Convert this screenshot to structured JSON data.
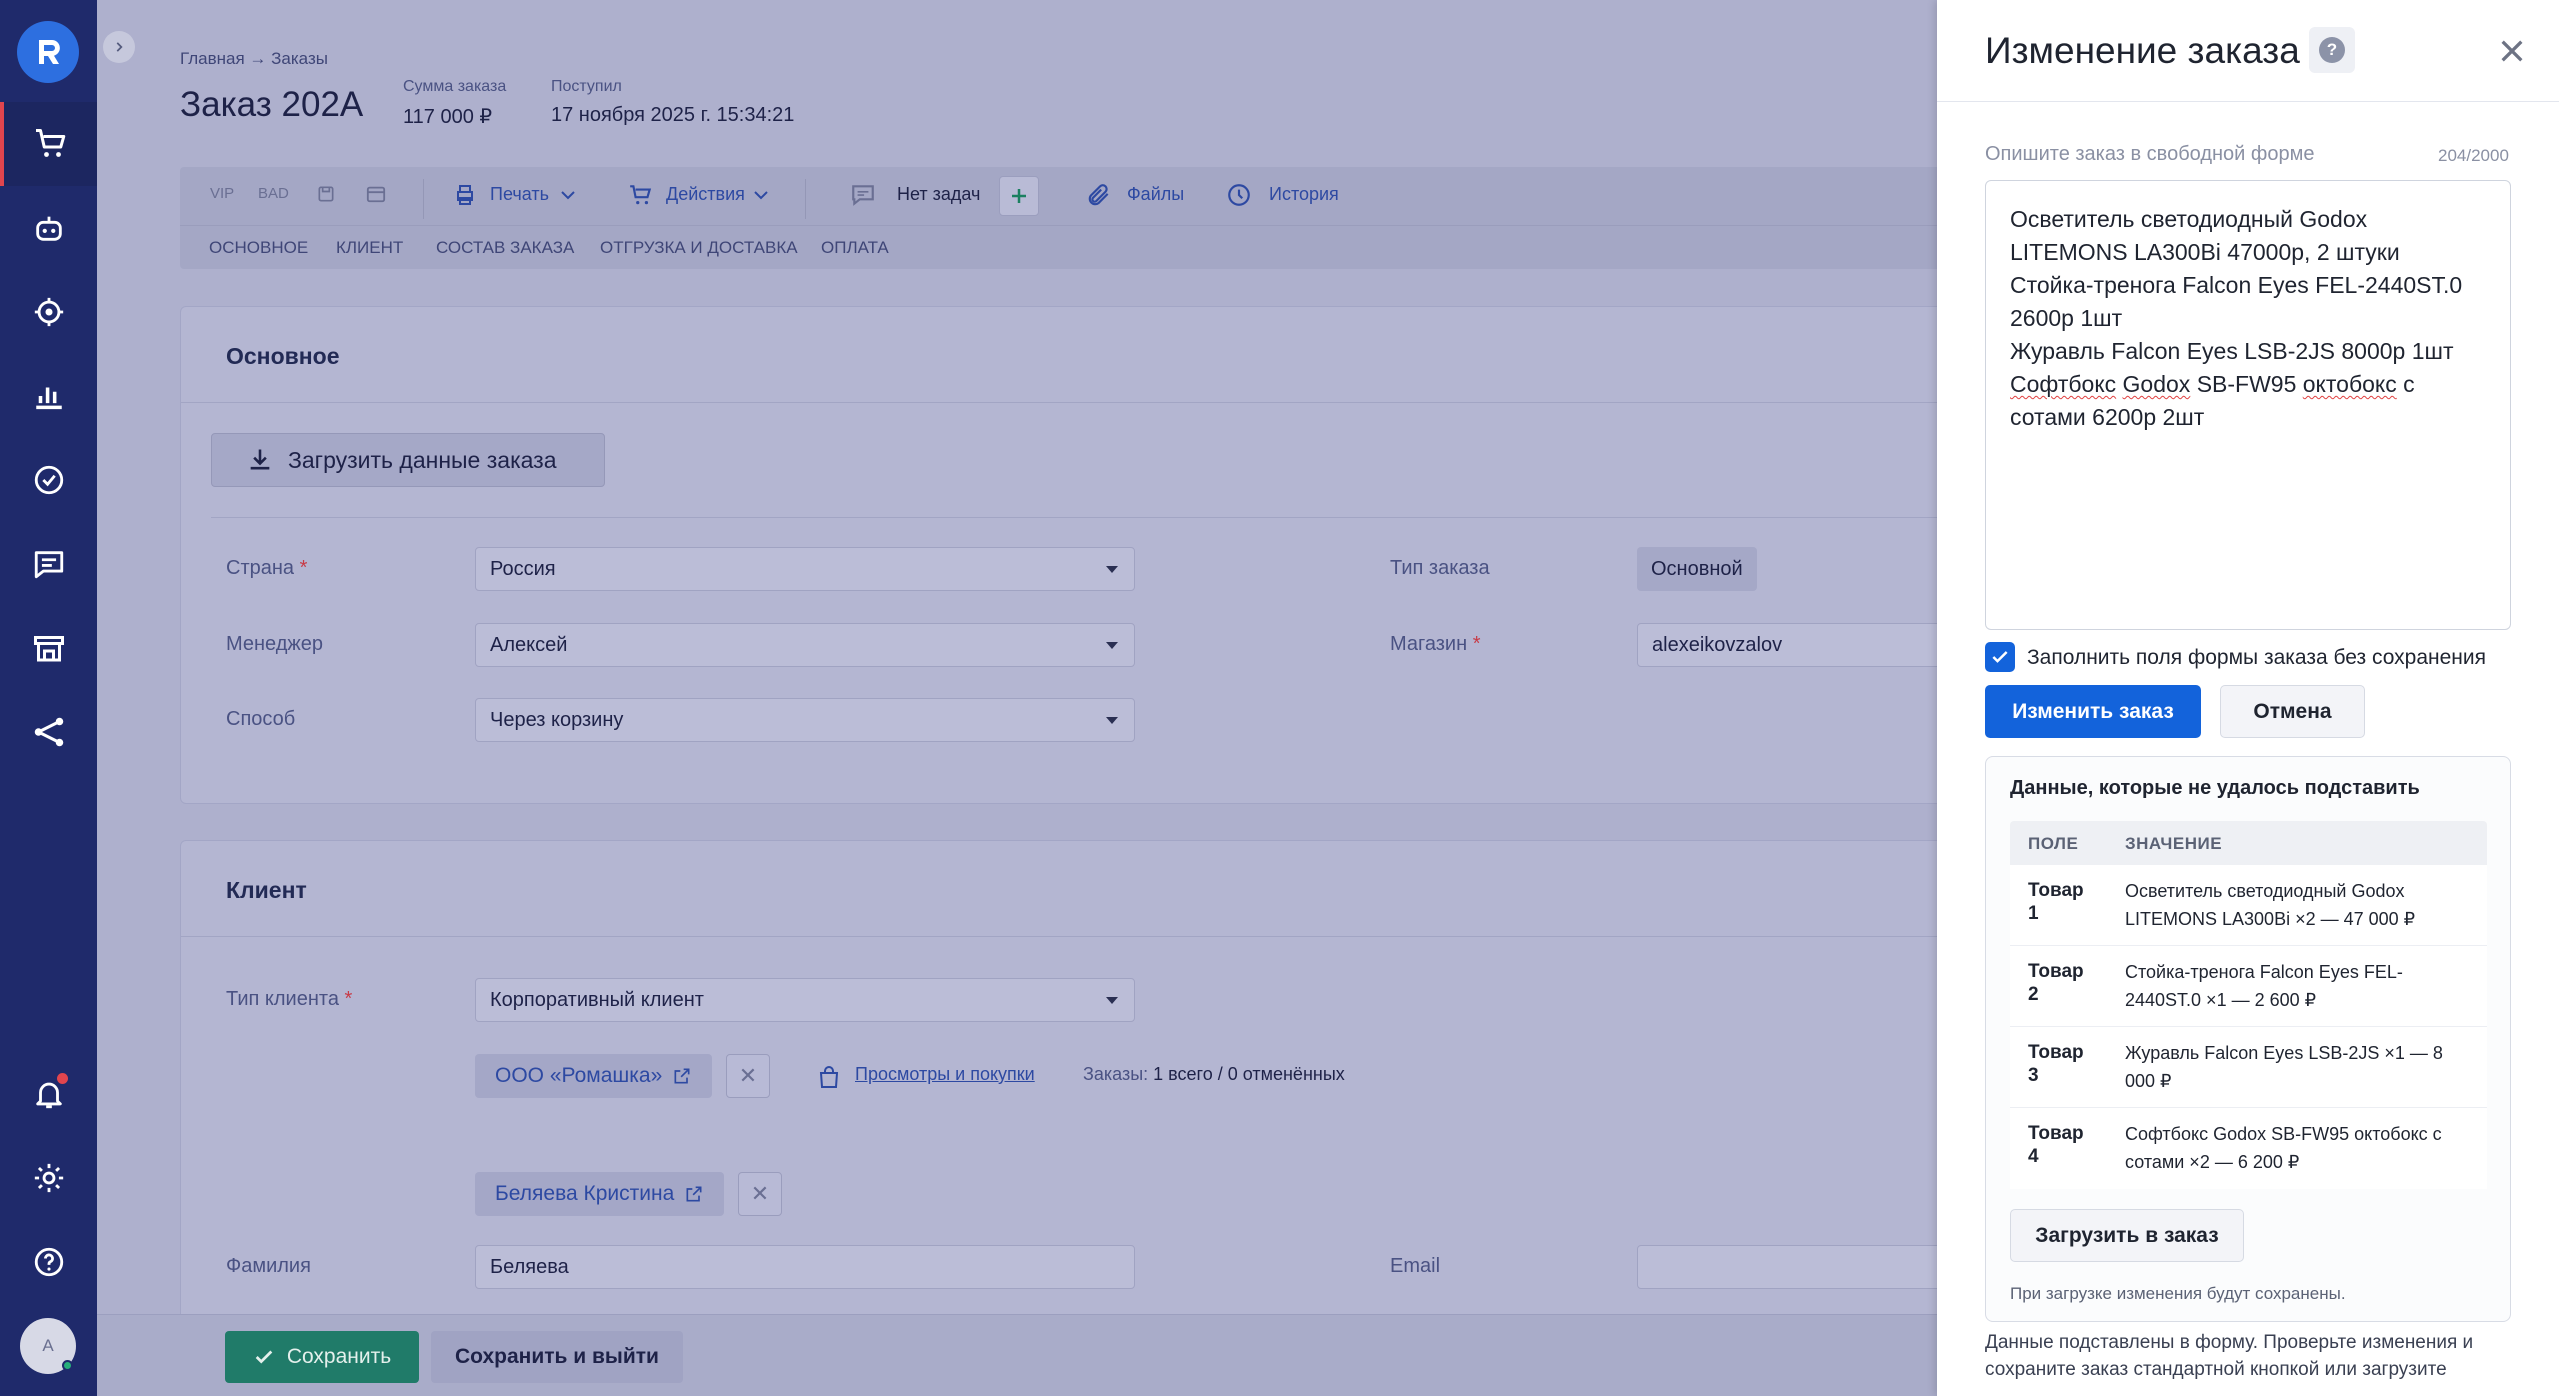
{
  "sidebar": {
    "items": [
      {
        "icon": "cart-icon"
      },
      {
        "icon": "robot-icon"
      },
      {
        "icon": "target-icon"
      },
      {
        "icon": "chart-icon"
      },
      {
        "icon": "check-circle-icon"
      },
      {
        "icon": "chat-icon"
      },
      {
        "icon": "store-icon"
      },
      {
        "icon": "share-icon"
      }
    ],
    "avatar_letter": "A"
  },
  "header": {
    "breadcrumb": "Главная → Заказы",
    "title": "Заказ 202А",
    "sum_label": "Сумма заказа",
    "sum_value": "117 000 ₽",
    "received_label": "Поступил",
    "received_value": "17 ноября 2025 г. 15:34:21"
  },
  "toolbar": {
    "vip": "VIP",
    "bad": "BAD",
    "print": "Печать",
    "actions": "Действия",
    "no_tasks": "Нет задач",
    "files": "Файлы",
    "history": "История"
  },
  "section_tabs": [
    "ОСНОВНОЕ",
    "КЛИЕНТ",
    "СОСТАВ ЗАКАЗА",
    "ОТГРУЗКА И ДОСТАВКА",
    "ОПЛАТА"
  ],
  "main_card": {
    "title": "Основное",
    "upload_button": "Загрузить данные заказа",
    "country_label": "Страна",
    "country_value": "Россия",
    "manager_label": "Менеджер",
    "manager_value": "Алексей",
    "method_label": "Способ",
    "method_value": "Через корзину",
    "order_type_label": "Тип заказа",
    "order_type_value": "Основной",
    "shop_label": "Магазин",
    "shop_value": "alexeikovzalov"
  },
  "client_card": {
    "title": "Клиент",
    "client_type_label": "Тип клиента",
    "client_type_value": "Корпоративный клиент",
    "company": "ООО «Ромашка»",
    "views_link": "Просмотры и покупки",
    "orders_label": "Заказы:",
    "orders_value": "1 всего / 0 отменённых",
    "contact": "Беляева Кристина",
    "lastname_label": "Фамилия",
    "lastname_value": "Беляева",
    "email_label": "Email"
  },
  "footer": {
    "save": "Сохранить",
    "save_exit": "Сохранить и выйти"
  },
  "panel": {
    "title": "Изменение заказа",
    "help": "?",
    "field_label": "Опишите заказ в свободной форме",
    "counter": "204/2000",
    "text_lines": [
      "Осветитель светодиодный Godox",
      "LITEMONS LA300Bi 47000р, 2 штуки",
      "Стойка-тренога Falcon Eyes FEL-2440ST.0",
      "2600р 1шт",
      "Журавль Falcon Eyes LSB-2JS 8000р 1шт"
    ],
    "text_line6_a": "Софтбокс",
    "text_line6_b": "Godox",
    "text_line6_c": "SB-FW95",
    "text_line6_d": "октобокс",
    "text_line6_e": "с",
    "text_line7": "сотами 6200р 2шт",
    "checkbox_label": "Заполнить поля формы заказа без сохранения",
    "submit": "Изменить заказ",
    "cancel": "Отмена",
    "failed_title": "Данные, которые не удалось подставить",
    "col_field": "ПОЛЕ",
    "col_value": "ЗНАЧЕНИЕ",
    "rows": [
      {
        "field": "Товар",
        "num": "1",
        "value": "Осветитель светодиодный Godox LITEMONS LA300Bi ×2 — 47 000 ₽"
      },
      {
        "field": "Товар",
        "num": "2",
        "value": "Стойка-тренога Falcon Eyes FEL-2440ST.0 ×1 — 2 600 ₽"
      },
      {
        "field": "Товар",
        "num": "3",
        "value": "Журавль Falcon Eyes LSB-2JS ×1 — 8 000 ₽"
      },
      {
        "field": "Товар",
        "num": "4",
        "value": "Софтбокс Godox SB-FW95 октобокс с сотами ×2 — 6 200 ₽"
      }
    ],
    "load_button": "Загрузить в заказ",
    "load_note": "При загрузке изменения будут сохранены.",
    "bottom_note_1": "Данные подставлены в форму. Проверьте изменения и",
    "bottom_note_2": "сохраните заказ стандартной кнопкой или загрузите"
  },
  "colors": {
    "sidebar": "#1f2a6b",
    "accent_blue": "#1363db",
    "save_green": "#207b69",
    "required": "#c83a46"
  }
}
